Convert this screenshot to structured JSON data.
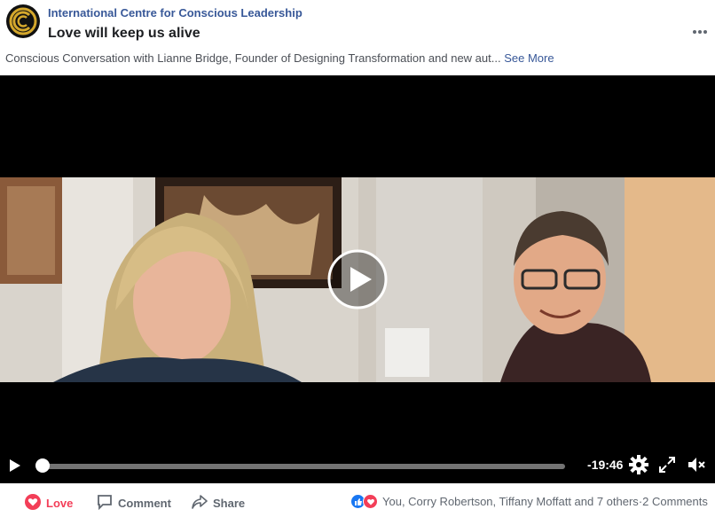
{
  "header": {
    "page_name": "International Centre for Conscious Leadership",
    "post_title": "Love will keep us alive"
  },
  "post": {
    "description": "Conscious Conversation with Lianne Bridge, Founder of Designing Transformation and new aut...",
    "see_more_label": "See More"
  },
  "video": {
    "time_remaining": "-19:46",
    "progress_fraction": 0.0
  },
  "actions": {
    "love_label": "Love",
    "comment_label": "Comment",
    "share_label": "Share"
  },
  "reactions": {
    "summary": "You, Corry Robertson, Tiffany Moffatt and 7 others",
    "separator": " · ",
    "comments": "2 Comments"
  },
  "colors": {
    "link": "#385898",
    "love": "#f33e58",
    "like": "#1877f2"
  }
}
